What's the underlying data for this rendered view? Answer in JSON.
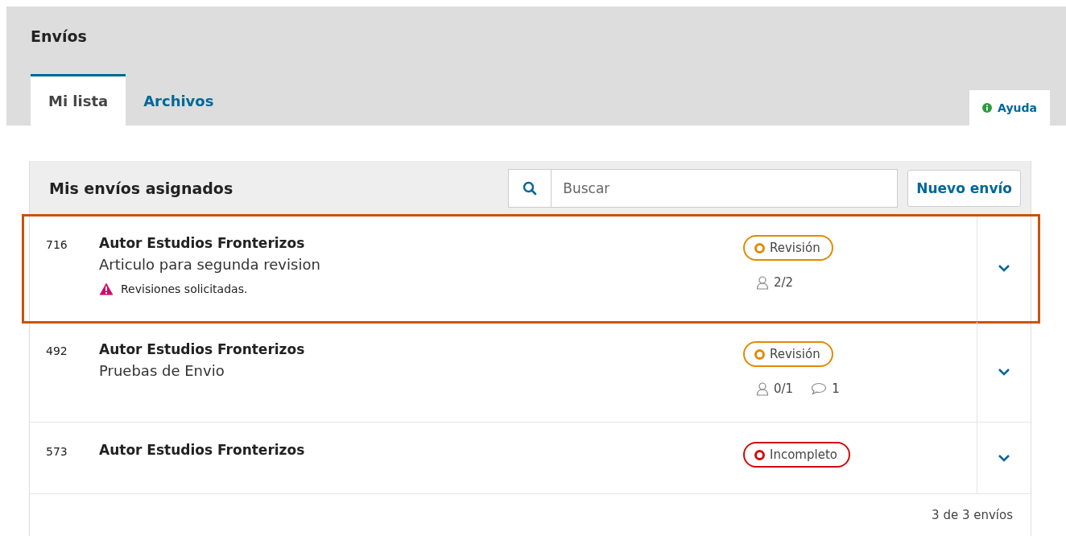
{
  "header": {
    "title": "Envíos"
  },
  "tabs": [
    {
      "label": "Mi lista",
      "selected": true
    },
    {
      "label": "Archivos",
      "selected": false
    }
  ],
  "help": {
    "label": "Ayuda"
  },
  "panel": {
    "title": "Mis envíos asignados",
    "search": {
      "placeholder": "Buscar"
    },
    "new_button": "Nuevo envío"
  },
  "submissions": [
    {
      "id": "716",
      "author": "Autor Estudios Fronterizos",
      "title": "Articulo para segunda revision",
      "notice": "Revisiones solicitadas.",
      "status": "Revisión",
      "color": "#e08a00",
      "reviewers": "2/2",
      "highlighted": true
    },
    {
      "id": "492",
      "author": "Autor Estudios Fronterizos",
      "title": "Pruebas de Envio",
      "status": "Revisión",
      "color": "#e08a00",
      "reviewers": "0/1",
      "comments": "1",
      "highlighted": false
    },
    {
      "id": "573",
      "author": "Autor Estudios Fronterizos",
      "status": "Incompleto",
      "color": "#d00a0a",
      "highlighted": false
    }
  ],
  "footer": "3 de 3 envíos"
}
